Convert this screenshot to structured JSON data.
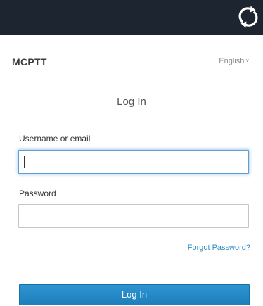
{
  "header": {
    "sync_icon": "sync-icon",
    "background": "#1d2530"
  },
  "brand": {
    "name": "MCPTT"
  },
  "language": {
    "selected": "English",
    "icon": "chevron-down-icon"
  },
  "form": {
    "title": "Log In",
    "username": {
      "label": "Username or email",
      "value": ""
    },
    "password": {
      "label": "Password",
      "value": ""
    },
    "forgot_link": "Forgot Password?",
    "submit_label": "Log In",
    "accent": "#2a8ac6"
  }
}
